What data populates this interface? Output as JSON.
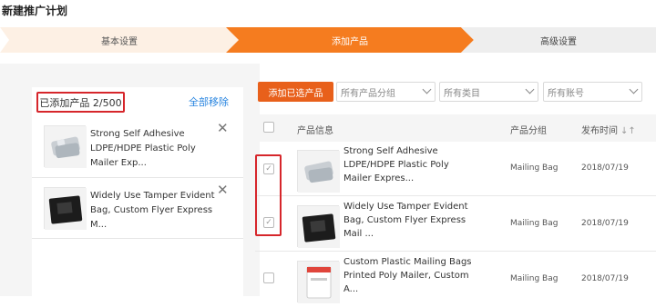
{
  "page_title": "新建推广计划",
  "steps": [
    "基本设置",
    "添加产品",
    "高级设置"
  ],
  "left": {
    "added_label": "已添加产品 2/500",
    "remove_all": "全部移除",
    "items": [
      {
        "title": "Strong Self Adhesive LDPE/HDPE Plastic Poly Mailer Exp..."
      },
      {
        "title": "Widely Use Tamper Evident Bag, Custom Flyer Express M..."
      }
    ]
  },
  "toolbar": {
    "add_selected": "添加已选产品",
    "group_select": "所有产品分组",
    "category_select": "所有类目",
    "account_select": "所有账号"
  },
  "table": {
    "headers": {
      "product": "产品信息",
      "group": "产品分组",
      "date": "发布时间"
    },
    "rows": [
      {
        "title": "Strong Self Adhesive LDPE/HDPE Plastic Poly Mailer Expres...",
        "group": "Mailing Bag",
        "date": "2018/07/19",
        "checked": true
      },
      {
        "title": "Widely Use Tamper Evident Bag, Custom Flyer Express Mail ...",
        "group": "Mailing Bag",
        "date": "2018/07/19",
        "checked": true
      },
      {
        "title": "Custom Plastic Mailing Bags Printed Poly Mailer, Custom A...",
        "group": "Mailing Bag",
        "date": "2018/07/19",
        "checked": false
      }
    ]
  },
  "colors": {
    "accent": "#f57c1f",
    "highlight": "#d6262b",
    "link": "#2a86e0"
  }
}
